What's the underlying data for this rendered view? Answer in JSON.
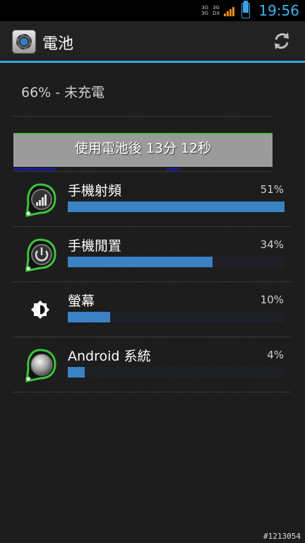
{
  "status_bar": {
    "network_top": "3G",
    "network_bottom": "3G",
    "network2_top": "3G",
    "network2_bottom": "DX",
    "time": "19:56"
  },
  "action_bar": {
    "title": "電池",
    "refresh_icon": "refresh-icon",
    "app_icon": "settings-gear-icon"
  },
  "summary": "66% - 未充電",
  "battery_level": 0.66,
  "time_on_battery": "使用電池後 13分 12秒",
  "usage": [
    {
      "label": "手機射頻",
      "percent_text": "51%",
      "percent": 51,
      "icon": "cell-signal-icon"
    },
    {
      "label": "手機閒置",
      "percent_text": "34%",
      "percent": 34,
      "icon": "power-icon"
    },
    {
      "label": "螢幕",
      "percent_text": "10%",
      "percent": 10,
      "icon": "brightness-icon"
    },
    {
      "label": "Android 系統",
      "percent_text": "4%",
      "percent": 4,
      "icon": "android-system-icon"
    }
  ],
  "watermark": "#1213054",
  "colors": {
    "accent": "#33a8e0",
    "bar_fill": "#3a82c4",
    "charge_line": "#47c147"
  }
}
